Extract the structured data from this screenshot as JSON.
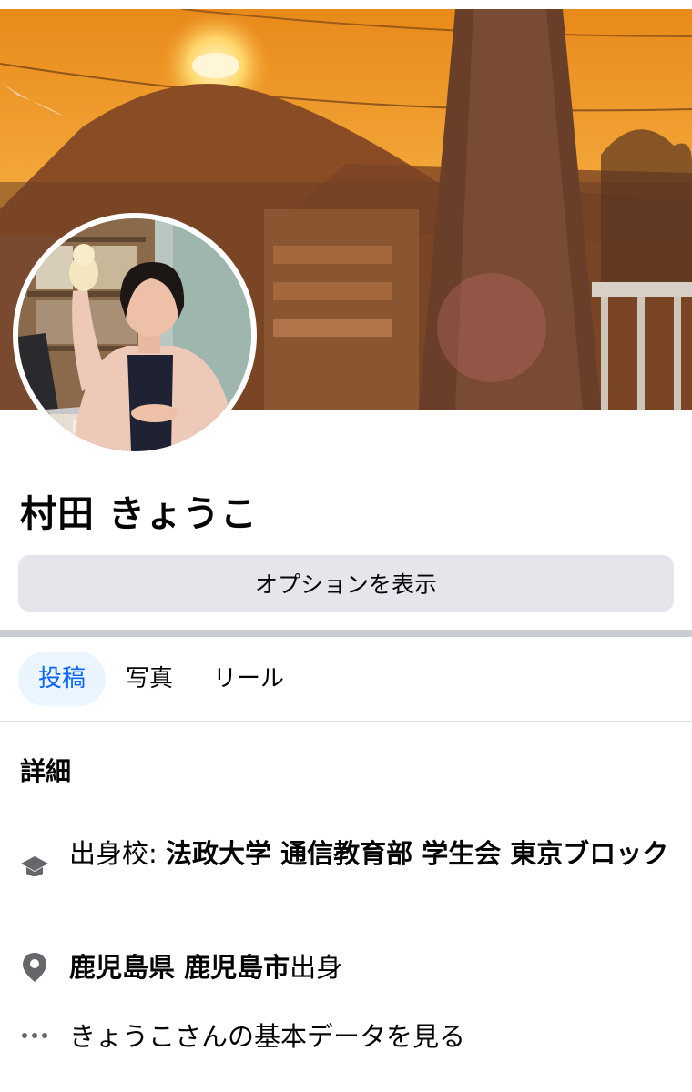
{
  "profile": {
    "name": "村田 きょうこ",
    "options_button": "オプションを表示"
  },
  "tabs": [
    {
      "label": "投稿",
      "active": true
    },
    {
      "label": "写真",
      "active": false
    },
    {
      "label": "リール",
      "active": false
    }
  ],
  "details": {
    "title": "詳細",
    "education": {
      "icon": "graduation-cap-icon",
      "prefix": "出身校: ",
      "school": "法政大学 通信教育部 学生会 東京ブロック"
    },
    "hometown": {
      "icon": "location-pin-icon",
      "place": "鹿児島県 鹿児島市",
      "suffix": "出身"
    },
    "more": {
      "icon": "more-dots-icon",
      "label": "きょうこさんの基本データを見る"
    }
  },
  "colors": {
    "accent": "#0866ff",
    "active_tab_bg": "#ebf5ff",
    "button_bg": "#e4e6eb",
    "icon_gray": "#65676b"
  }
}
